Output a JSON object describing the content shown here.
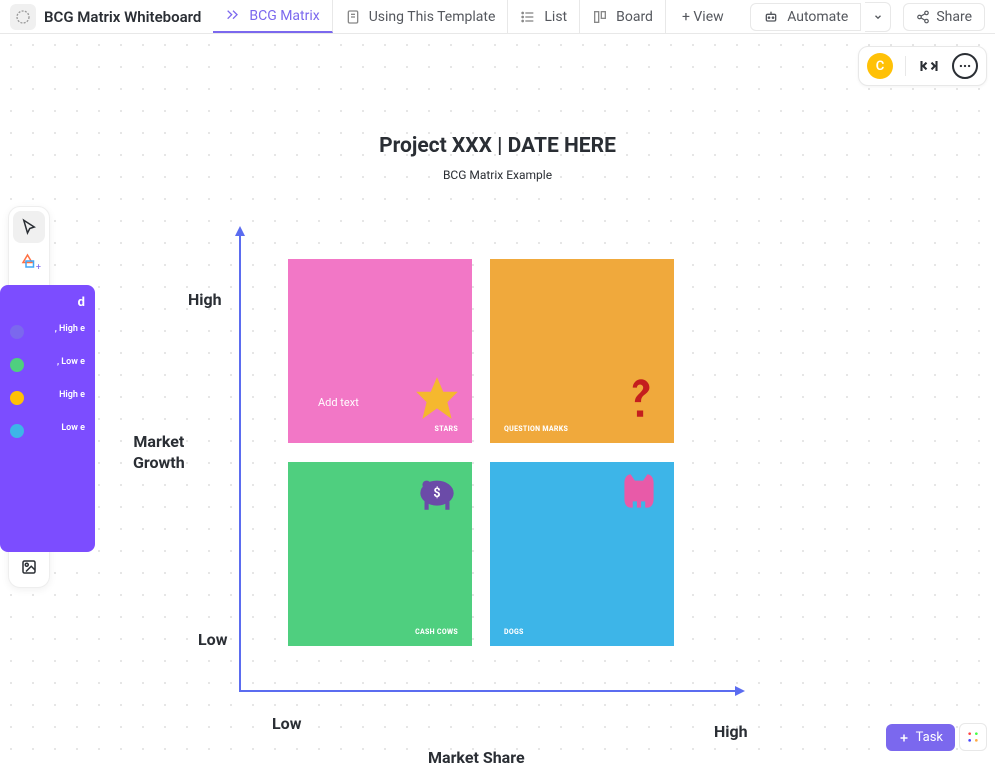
{
  "header": {
    "board_name": "BCG Matrix Whiteboard",
    "tabs": [
      {
        "label": "BCG Matrix"
      },
      {
        "label": "Using This Template"
      },
      {
        "label": "List"
      },
      {
        "label": "Board"
      }
    ],
    "view_label": "+ View",
    "automate_label": "Automate",
    "share_label": "Share"
  },
  "float": {
    "avatar_initial": "C"
  },
  "legend": {
    "title": "d",
    "items": [
      {
        "color": "#7b68ee",
        "text": ", High\ne"
      },
      {
        "color": "#4fcf7f",
        "text": ", Low\ne"
      },
      {
        "color": "#ffc107",
        "text": "High\ne"
      },
      {
        "color": "#3db5e8",
        "text": "Low\ne"
      }
    ]
  },
  "chart_data": {
    "type": "matrix",
    "title": "Project XXX | DATE HERE",
    "subtitle": "BCG Matrix Example",
    "xlabel": "Market Share",
    "ylabel": "Market Growth",
    "x_low": "Low",
    "x_high": "High",
    "y_low": "Low",
    "y_high": "High",
    "quadrants": [
      {
        "name": "STARS",
        "color": "#f277c6",
        "growth": "High",
        "share": "Low",
        "placeholder": "Add text"
      },
      {
        "name": "QUESTION MARKS",
        "color": "#f0a93c",
        "growth": "High",
        "share": "High"
      },
      {
        "name": "CASH COWS",
        "color": "#4fcf7f",
        "growth": "Low",
        "share": "Low"
      },
      {
        "name": "DOGS",
        "color": "#3db5e8",
        "growth": "Low",
        "share": "High"
      }
    ]
  },
  "task_btn": "Task"
}
